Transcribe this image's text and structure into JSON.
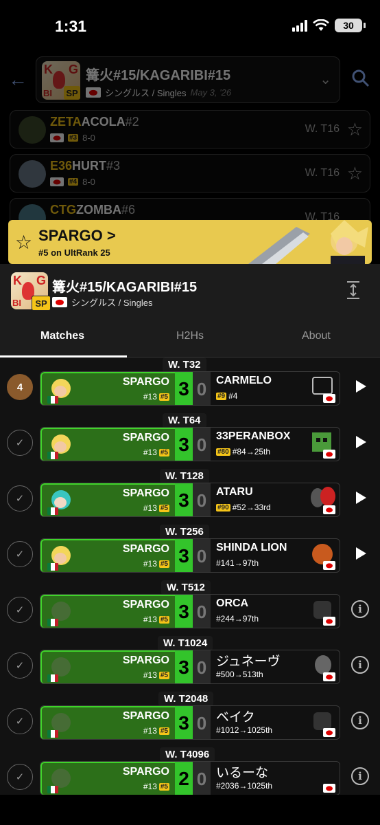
{
  "status_bar": {
    "time": "1:31",
    "battery": "30"
  },
  "background": {
    "event_title": "篝火#15/KAGARIBI#15",
    "event_badge": "SP",
    "event_subtitle": "シングルス / Singles",
    "event_date": "May 3, '26",
    "rows": [
      {
        "tag": "ZETA",
        "name": "ACOLA",
        "seed": "#2",
        "rank_badge": "#3",
        "record": "8-0",
        "round": "W. T16"
      },
      {
        "tag": "E36",
        "name": "HURT",
        "seed": "#3",
        "rank_badge": "#4",
        "record": "8-0",
        "round": "W. T16"
      },
      {
        "tag": "CTG",
        "name": "ZOMBA",
        "seed": "#6",
        "rank_badge": "",
        "record": "",
        "round": "W. T16"
      }
    ]
  },
  "banner": {
    "name": "SPARGO",
    "arrow": ">",
    "subtitle": "#5 on UltRank 25"
  },
  "panel": {
    "title": "篝火#15/KAGARIBI#15",
    "badge": "SP",
    "subtitle": "シングルス / Singles"
  },
  "tabs": [
    {
      "label": "Matches"
    },
    {
      "label": "H2Hs"
    },
    {
      "label": "About"
    }
  ],
  "matches": [
    {
      "round": "W. T32",
      "status": "4",
      "winner": "SPARGO",
      "w_seed": "#13",
      "w_badge": "#5",
      "score_w": "3",
      "score_l": "0",
      "loser": "CARMELO",
      "l_badge": "#9",
      "l_seed": "#4",
      "action": "play"
    },
    {
      "round": "W. T64",
      "status": "✓",
      "winner": "SPARGO",
      "w_seed": "#13",
      "w_badge": "#5",
      "score_w": "3",
      "score_l": "0",
      "loser": "33PERANBOX",
      "l_badge": "#80",
      "l_seed": "#84→25th",
      "action": "play"
    },
    {
      "round": "W. T128",
      "status": "✓",
      "winner": "SPARGO",
      "w_seed": "#13",
      "w_badge": "#5",
      "score_w": "3",
      "score_l": "0",
      "loser": "ATARU",
      "l_badge": "#90",
      "l_seed": "#52→33rd",
      "action": "play"
    },
    {
      "round": "W. T256",
      "status": "✓",
      "winner": "SPARGO",
      "w_seed": "#13",
      "w_badge": "#5",
      "score_w": "3",
      "score_l": "0",
      "loser": "SHINDA LION",
      "l_badge": "",
      "l_seed": "#141→97th",
      "action": "play"
    },
    {
      "round": "W. T512",
      "status": "✓",
      "winner": "SPARGO",
      "w_seed": "#13",
      "w_badge": "#5",
      "score_w": "3",
      "score_l": "0",
      "loser": "ORCA",
      "l_badge": "",
      "l_seed": "#244→97th",
      "action": "info"
    },
    {
      "round": "W. T1024",
      "status": "✓",
      "winner": "SPARGO",
      "w_seed": "#13",
      "w_badge": "#5",
      "score_w": "3",
      "score_l": "0",
      "loser": "ジュネーヴ",
      "l_badge": "",
      "l_seed": "#500→513th",
      "action": "info"
    },
    {
      "round": "W. T2048",
      "status": "✓",
      "winner": "SPARGO",
      "w_seed": "#13",
      "w_badge": "#5",
      "score_w": "3",
      "score_l": "0",
      "loser": "ベイク",
      "l_badge": "",
      "l_seed": "#1012→1025th",
      "action": "info"
    },
    {
      "round": "W. T4096",
      "status": "✓",
      "winner": "SPARGO",
      "w_seed": "#13",
      "w_badge": "#5",
      "score_w": "2",
      "score_l": "0",
      "loser": "いるーな",
      "l_badge": "",
      "l_seed": "#2036→1025th",
      "action": "info"
    }
  ],
  "colors": {
    "accent_gold": "#f5c518",
    "win_green": "#33c42b",
    "win_bg": "#2c6f19",
    "banner": "#e8c94f"
  }
}
